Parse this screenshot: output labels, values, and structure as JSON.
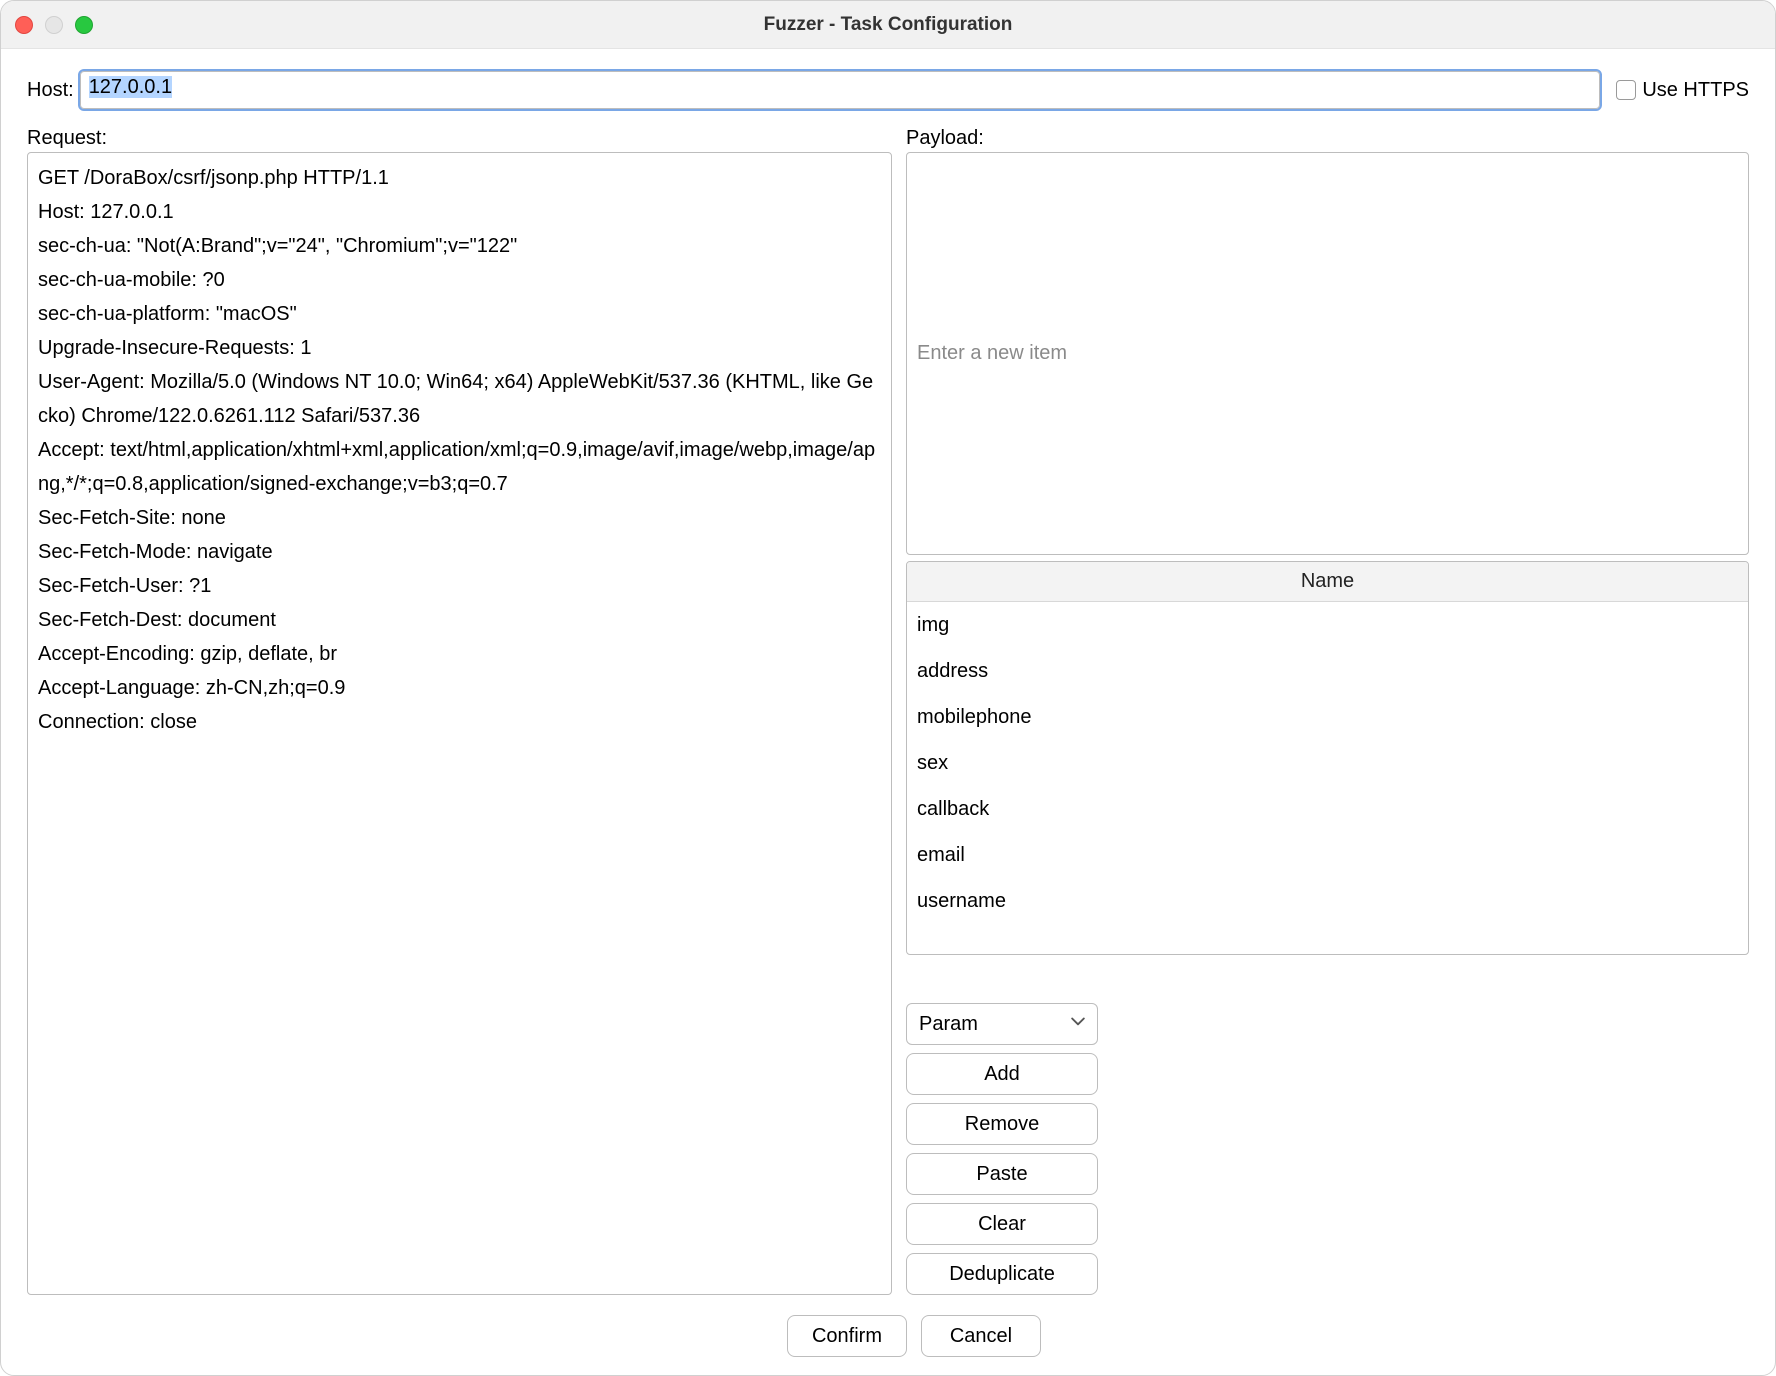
{
  "window": {
    "title": "Fuzzer - Task Configuration"
  },
  "host": {
    "label": "Host:",
    "value": "127.0.0.1",
    "use_https_label": "Use HTTPS",
    "use_https_checked": false
  },
  "request": {
    "label": "Request:",
    "text": "GET /DoraBox/csrf/jsonp.php HTTP/1.1\nHost: 127.0.0.1\nsec-ch-ua: \"Not(A:Brand\";v=\"24\", \"Chromium\";v=\"122\"\nsec-ch-ua-mobile: ?0\nsec-ch-ua-platform: \"macOS\"\nUpgrade-Insecure-Requests: 1\nUser-Agent: Mozilla/5.0 (Windows NT 10.0; Win64; x64) AppleWebKit/537.36 (KHTML, like Gecko) Chrome/122.0.6261.112 Safari/537.36\nAccept: text/html,application/xhtml+xml,application/xml;q=0.9,image/avif,image/webp,image/apng,*/*;q=0.8,application/signed-exchange;v=b3;q=0.7\nSec-Fetch-Site: none\nSec-Fetch-Mode: navigate\nSec-Fetch-User: ?1\nSec-Fetch-Dest: document\nAccept-Encoding: gzip, deflate, br\nAccept-Language: zh-CN,zh;q=0.9\nConnection: close"
  },
  "payload": {
    "label": "Payload:",
    "new_item_placeholder": "Enter a new item",
    "combo_value": "Param",
    "table_header": "Name",
    "items": [
      "img",
      "address",
      "mobilephone",
      "sex",
      "callback",
      "email",
      "username"
    ]
  },
  "buttons": {
    "add": "Add",
    "remove": "Remove",
    "paste": "Paste",
    "clear": "Clear",
    "dedup": "Deduplicate",
    "confirm": "Confirm",
    "cancel": "Cancel"
  }
}
